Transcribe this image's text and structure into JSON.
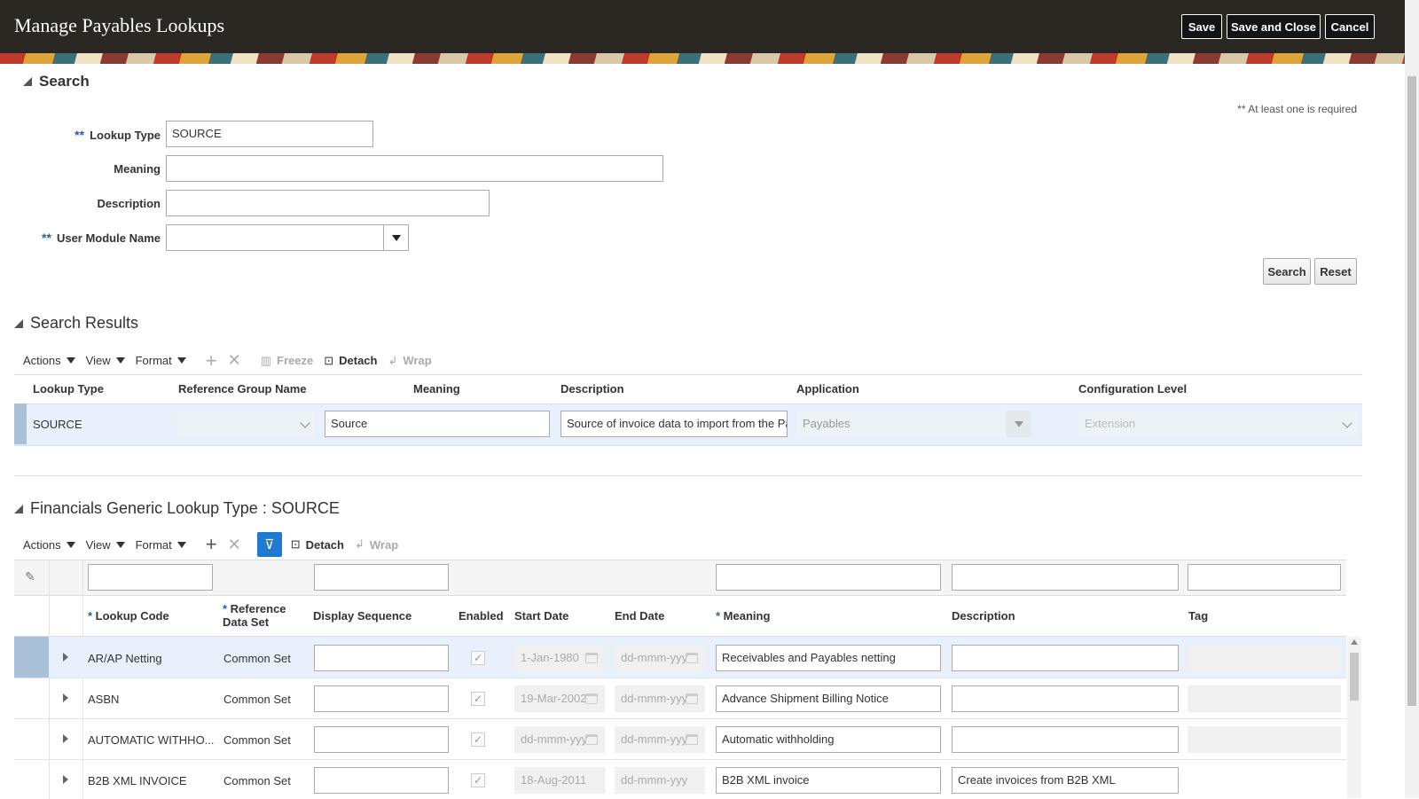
{
  "header": {
    "title": "Manage Payables Lookups",
    "save": "Save",
    "save_close": "Save and Close",
    "cancel": "Cancel"
  },
  "search": {
    "title": "Search",
    "required_note": "** At least one is required",
    "req_mark": "**",
    "lookup_type_label": "Lookup Type",
    "lookup_type_value": "SOURCE",
    "meaning_label": "Meaning",
    "meaning_value": "",
    "description_label": "Description",
    "description_value": "",
    "module_label": "User Module Name",
    "module_value": "",
    "search_btn": "Search",
    "reset_btn": "Reset"
  },
  "toolbar": {
    "actions": "Actions",
    "view": "View",
    "format": "Format",
    "freeze": "Freeze",
    "detach": "Detach",
    "wrap": "Wrap"
  },
  "results": {
    "title": "Search Results",
    "columns": [
      "Lookup Type",
      "Reference Group Name",
      "Meaning",
      "Description",
      "Application",
      "Configuration Level"
    ],
    "row": {
      "lookup_type": "SOURCE",
      "reference_group": "",
      "meaning": "Source",
      "description": "Source of invoice data to import from the Pay",
      "application": "Payables",
      "config_level": "Extension"
    }
  },
  "detail": {
    "title": "Financials Generic Lookup Type : SOURCE",
    "columns": {
      "lookup_code": "Lookup Code",
      "ref_set_1": "Reference",
      "ref_set_2": "Data Set",
      "display_seq": "Display Sequence",
      "enabled": "Enabled",
      "start_date": "Start Date",
      "end_date": "End Date",
      "meaning": "Meaning",
      "description": "Description",
      "tag": "Tag"
    },
    "rows": [
      {
        "code": "AR/AP Netting",
        "set": "Common Set",
        "start": "1-Jan-1980",
        "end": "dd-mmm-yyy",
        "meaning": "Receivables and Payables netting",
        "description": ""
      },
      {
        "code": "ASBN",
        "set": "Common Set",
        "start": "19-Mar-2002",
        "end": "dd-mmm-yyy",
        "meaning": "Advance Shipment Billing Notice",
        "description": ""
      },
      {
        "code": "AUTOMATIC WITHHO...",
        "set": "Common Set",
        "start": "dd-mmm-yyy",
        "end": "dd-mmm-yyy",
        "meaning": "Automatic withholding",
        "description": ""
      },
      {
        "code": "B2B XML INVOICE",
        "set": "Common Set",
        "start": "18-Aug-2011",
        "end": "dd-mmm-yyy",
        "meaning": "B2B XML invoice",
        "description": "Create invoices from B2B XML"
      }
    ]
  }
}
